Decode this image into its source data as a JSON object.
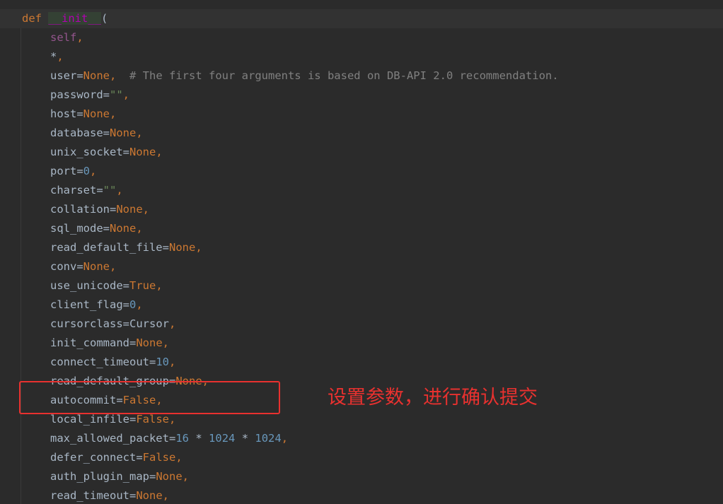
{
  "code": {
    "def_keyword": "def",
    "func_name": "__init__",
    "open_paren": "(",
    "self": "self",
    "star": "*",
    "params": [
      {
        "name": "user",
        "value": "None",
        "kind": "kw",
        "comment": "# The first four arguments is based on DB-API 2.0 recommendation."
      },
      {
        "name": "password",
        "value": "\"\"",
        "kind": "str"
      },
      {
        "name": "host",
        "value": "None",
        "kind": "kw"
      },
      {
        "name": "database",
        "value": "None",
        "kind": "kw"
      },
      {
        "name": "unix_socket",
        "value": "None",
        "kind": "kw"
      },
      {
        "name": "port",
        "value": "0",
        "kind": "num"
      },
      {
        "name": "charset",
        "value": "\"\"",
        "kind": "str"
      },
      {
        "name": "collation",
        "value": "None",
        "kind": "kw"
      },
      {
        "name": "sql_mode",
        "value": "None",
        "kind": "kw"
      },
      {
        "name": "read_default_file",
        "value": "None",
        "kind": "kw"
      },
      {
        "name": "conv",
        "value": "None",
        "kind": "kw"
      },
      {
        "name": "use_unicode",
        "value": "True",
        "kind": "kw"
      },
      {
        "name": "client_flag",
        "value": "0",
        "kind": "num"
      },
      {
        "name": "cursorclass",
        "value": "Cursor",
        "kind": "plain"
      },
      {
        "name": "init_command",
        "value": "None",
        "kind": "kw"
      },
      {
        "name": "connect_timeout",
        "value": "10",
        "kind": "num"
      },
      {
        "name": "read_default_group",
        "value": "None",
        "kind": "kw"
      },
      {
        "name": "autocommit",
        "value": "False",
        "kind": "kw"
      },
      {
        "name": "local_infile",
        "value": "False",
        "kind": "kw"
      },
      {
        "name": "max_allowed_packet",
        "value": "16 * 1024 * 1024",
        "kind": "expr"
      },
      {
        "name": "defer_connect",
        "value": "False",
        "kind": "kw"
      },
      {
        "name": "auth_plugin_map",
        "value": "None",
        "kind": "kw"
      },
      {
        "name": "read_timeout",
        "value": "None",
        "kind": "kw"
      }
    ]
  },
  "annotation": {
    "text": "设置参数，进行确认提交"
  },
  "colors": {
    "background": "#2b2b2b",
    "keyword": "#cc7832",
    "number": "#6897bb",
    "string": "#6a8759",
    "comment": "#808080",
    "self": "#94558d",
    "magic": "#b200b2",
    "annotation": "#e8312f"
  }
}
